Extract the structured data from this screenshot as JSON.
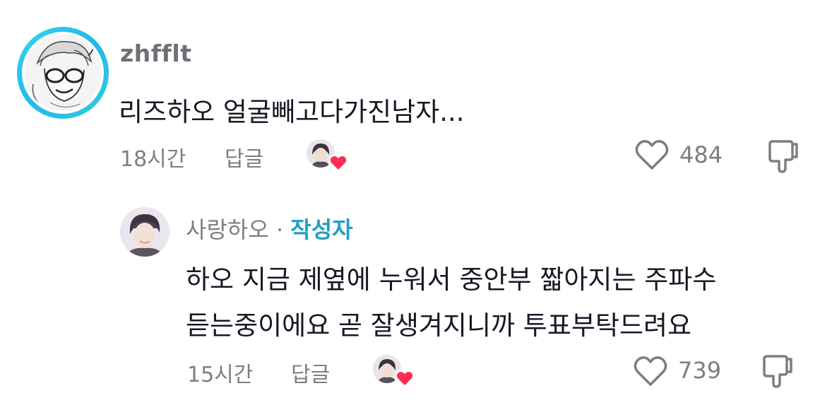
{
  "comment": {
    "username": "zhfflt",
    "text": "리즈하오 얼굴빼고다가진남자...",
    "time": "18시간",
    "reply_label": "답글",
    "like_count": "484"
  },
  "reply": {
    "username": "사랑하오",
    "separator": " · ",
    "author_badge": "작성자",
    "text_line1": "하오 지금 제옆에 누워서 중안부 짧아지는 주파수",
    "text_line2": "듣는중이에요 곧 잘생겨지니까 투표부탁드려요",
    "time": "15시간",
    "reply_label": "답글",
    "like_count": "739"
  },
  "icons": {
    "like": "heart-outline-icon",
    "dislike": "thumbs-down-icon",
    "creator_liked": "red-heart-icon"
  },
  "colors": {
    "accent": "#1f9fc8",
    "ring": "#25b7e8",
    "heart": "#fe2c55",
    "meta": "#7d7e83"
  }
}
